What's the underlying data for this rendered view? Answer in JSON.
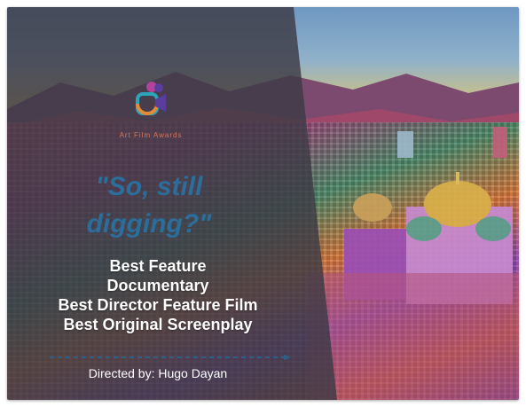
{
  "logo": {
    "icon": "film-camera-icon",
    "label": "Art Film Awards",
    "colors": {
      "teal": "#2aa6b8",
      "orange": "#e08a3a",
      "magenta": "#b0439a",
      "purple": "#5a3d9c"
    }
  },
  "quote": {
    "line1": "\"So, still",
    "line2": "digging?\""
  },
  "awards": [
    "Best Feature",
    "Documentary",
    "Best Director Feature Film",
    "Best Original Screenplay"
  ],
  "credit": "Directed by: Hugo Dayan",
  "colors": {
    "panel": "#3f3f47",
    "quote": "#2b6e9c",
    "award_text": "#ffffff",
    "divider": "#2f5f86"
  }
}
